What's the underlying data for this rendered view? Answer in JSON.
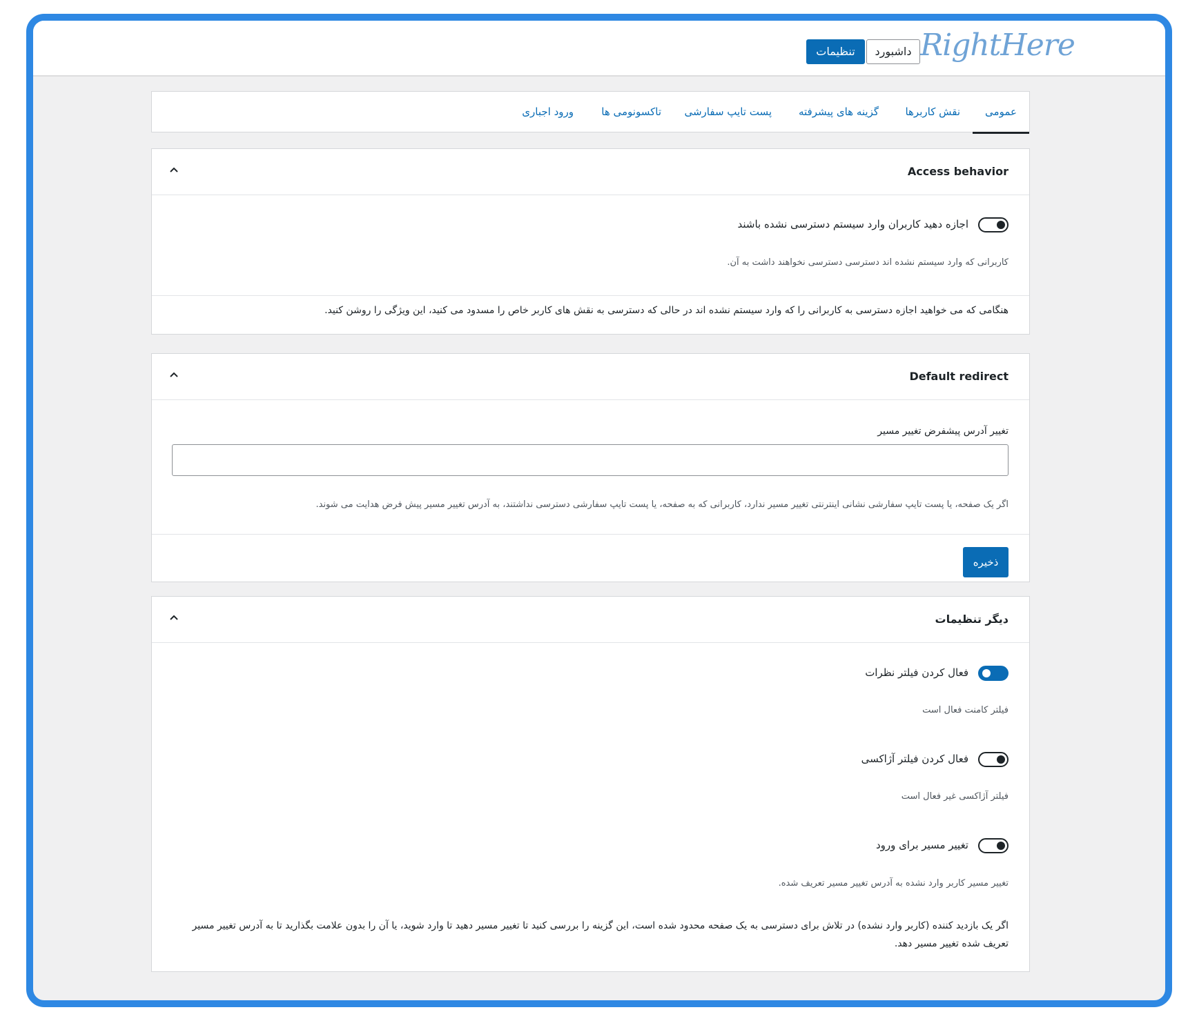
{
  "header": {
    "logo": "RightHere",
    "settings_label": "تنظیمات",
    "dashboard_label": "داشبورد"
  },
  "tabs": [
    {
      "label": "عمومی",
      "active": true
    },
    {
      "label": "نقش کاربرها"
    },
    {
      "label": "گزینه های پیشرفته"
    },
    {
      "label": "پست تایپ سفارشی"
    },
    {
      "label": "تاکسونومی ها"
    },
    {
      "label": "ورود اجباری"
    }
  ],
  "access": {
    "title": "Access behavior",
    "toggle_label": "اجازه دهید کاربران وارد سیستم دسترسی نشده باشند",
    "toggle_state": "off",
    "hint": "کاربرانی که وارد سیستم نشده اند دسترسی دسترسی نخواهند داشت به آن.",
    "note": "هنگامی که می خواهید اجازه دسترسی به کاربرانی را که وارد سیستم نشده اند در حالی که دسترسی به نقش های کاربر خاص را مسدود می کنید، این ویژگی را روشن کنید."
  },
  "redirect": {
    "title": "Default redirect",
    "field_label": "تغییر آدرس پیشفرض تغییر مسیر",
    "field_value": "",
    "hint": "اگر یک صفحه، یا پست تایپ سفارشی نشانی اینترنتی تغییر مسیر ندارد، کاربرانی که به صفحه، یا پست تایپ سفارشی دسترسی نداشتند، به آدرس تغییر مسیر پیش فرض هدایت می شوند.",
    "save_label": "ذخیره"
  },
  "other": {
    "title": "دیگر تنظیمات",
    "comment_filter": {
      "label": "فعال کردن فیلتر نظرات",
      "hint": "فیلتر کامنت فعال است",
      "state": "on"
    },
    "ajax_filter": {
      "label": "فعال کردن فیلتر آژاکسی",
      "hint": "فیلتر آژاکسی غیر فعال است",
      "state": "off"
    },
    "login_redirect": {
      "label": "تغییر مسیر برای ورود",
      "hint": "تغییر مسیر کاربر وارد نشده به آدرس تغییر مسیر تعریف شده.",
      "state": "off",
      "note": "اگر یک بازدید کننده (کاربر وارد نشده) در تلاش برای دسترسی به یک صفحه محدود شده است، این گزینه را بررسی کنید تا تغییر مسیر دهید تا وارد شوید، یا آن را بدون علامت بگذارید تا به آدرس تغییر مسیر تعریف شده تغییر مسیر دهد."
    }
  },
  "colors": {
    "accent": "#0a6cb5",
    "frame": "#2e88e3"
  }
}
